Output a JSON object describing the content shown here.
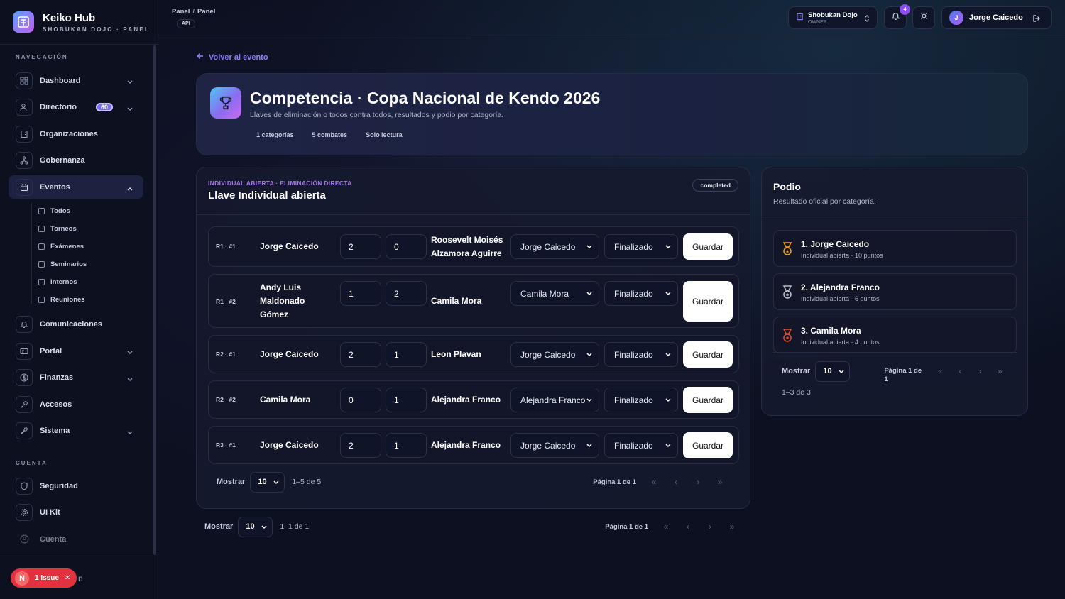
{
  "brand": {
    "name": "Keiko Hub",
    "subtitle": "SHOBUKAN DOJO · PANEL"
  },
  "sidebar": {
    "nav_title": "NAVEGACIÓN",
    "account_title": "CUENTA",
    "items": [
      {
        "label": "Dashboard"
      },
      {
        "label": "Directorio",
        "badge": "60"
      },
      {
        "label": "Organizaciones"
      },
      {
        "label": "Gobernanza"
      },
      {
        "label": "Eventos"
      },
      {
        "label": "Comunicaciones"
      },
      {
        "label": "Portal"
      },
      {
        "label": "Finanzas"
      },
      {
        "label": "Accesos"
      },
      {
        "label": "Sistema"
      }
    ],
    "event_sub": [
      "Todos",
      "Torneos",
      "Exámenes",
      "Seminarios",
      "Internos",
      "Reuniones"
    ],
    "account_items": [
      {
        "label": "Seguridad"
      },
      {
        "label": "UI Kit"
      },
      {
        "label": "Cuenta"
      }
    ]
  },
  "issue": {
    "letter": "N",
    "label": "1 Issue",
    "tail": "n"
  },
  "topbar": {
    "crumbs": [
      "Panel",
      "Panel"
    ],
    "api": "API",
    "org_name": "Shobukan Dojo",
    "org_role": "OWNER",
    "notifications": "4",
    "user_initial": "J",
    "user_name": "Jorge Caicedo"
  },
  "back_link": "Volver al evento",
  "hero": {
    "title": "Competencia · Copa Nacional de Kendo 2026",
    "subtitle": "Llaves de eliminación o todos contra todos, resultados y podio por categoría.",
    "chips": [
      "1 categorías",
      "5 combates",
      "Solo lectura"
    ]
  },
  "bracket": {
    "eyebrow": "INDIVIDUAL ABIERTA · ELIMINACIÓN DIRECTA",
    "title": "Llave Individual abierta",
    "status": "completed",
    "save_label": "Guardar",
    "matches": [
      {
        "round": "R1 · #1",
        "p1": "Jorge Caicedo",
        "s1": "2",
        "s2": "0",
        "p2": "Roosevelt Moisés Alzamora Aguirre",
        "winner": "Jorge Caicedo",
        "state": "Finalizado"
      },
      {
        "round": "R1 · #2",
        "p1": "Andy Luis Maldonado Gómez",
        "s1": "1",
        "s2": "2",
        "p2": "Camila Mora",
        "winner": "Camila Mora",
        "state": "Finalizado"
      },
      {
        "round": "R2 · #1",
        "p1": "Jorge Caicedo",
        "s1": "2",
        "s2": "1",
        "p2": "Leon Plavan",
        "winner": "Jorge Caicedo",
        "state": "Finalizado"
      },
      {
        "round": "R2 · #2",
        "p1": "Camila Mora",
        "s1": "0",
        "s2": "1",
        "p2": "Alejandra Franco",
        "winner": "Alejandra Franco",
        "state": "Finalizado"
      },
      {
        "round": "R3 · #1",
        "p1": "Jorge Caicedo",
        "s1": "2",
        "s2": "1",
        "p2": "Alejandra Franco",
        "winner": "Jorge Caicedo",
        "state": "Finalizado"
      }
    ],
    "pager": {
      "label": "Mostrar",
      "size": "10",
      "range": "1–5 de 5",
      "page": "Página 1 de 1"
    }
  },
  "outer_pager": {
    "label": "Mostrar",
    "size": "10",
    "range": "1–1 de 1",
    "page": "Página 1 de 1"
  },
  "podium": {
    "title": "Podio",
    "subtitle": "Resultado oficial por categoría.",
    "items": [
      {
        "name": "1. Jorge Caicedo",
        "detail": "Individual abierta · 10 puntos",
        "color": "#f0a020"
      },
      {
        "name": "2. Alejandra Franco",
        "detail": "Individual abierta · 6 puntos",
        "color": "#b8bcc8"
      },
      {
        "name": "3. Camila Mora",
        "detail": "Individual abierta · 4 puntos",
        "color": "#e0502a"
      }
    ],
    "pager": {
      "label": "Mostrar",
      "size": "10",
      "range": "1–3 de 3",
      "page_a": "Página 1 de",
      "page_b": "1"
    }
  },
  "colors": {
    "accent": "#8c7cff",
    "eyebrow": "#a774f0",
    "issue": "#e0323f"
  }
}
